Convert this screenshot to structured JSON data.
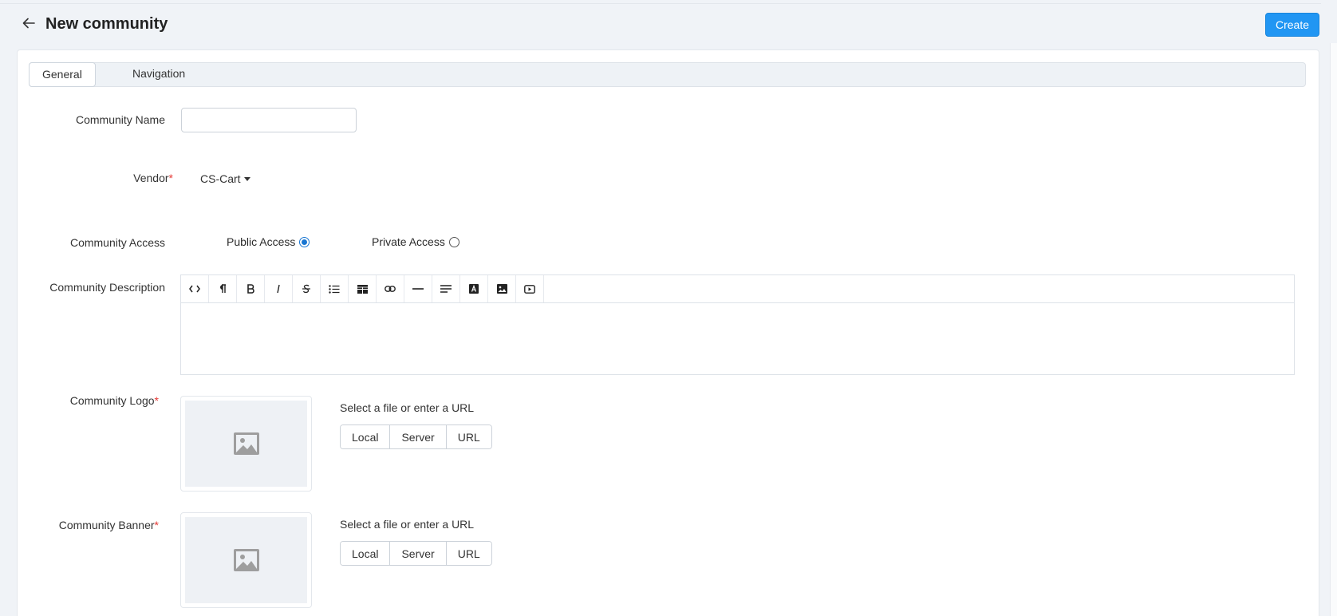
{
  "header": {
    "title": "New community",
    "create_label": "Create"
  },
  "tabs": [
    {
      "label": "General",
      "active": true
    },
    {
      "label": "Navigation",
      "active": false
    }
  ],
  "form": {
    "name_label": "Community Name",
    "name_value": "",
    "vendor_label": "Vendor",
    "vendor_value": "CS-Cart",
    "access_label": "Community Access",
    "access_options": [
      {
        "label": "Public Access",
        "checked": true
      },
      {
        "label": "Private Access",
        "checked": false
      }
    ],
    "description_label": "Community Description",
    "logo_label": "Community Logo",
    "banner_label": "Community Banner",
    "required_mark": "*",
    "upload_hint": "Select a file or enter a URL",
    "upload_sources": [
      "Local",
      "Server",
      "URL"
    ]
  },
  "editor_toolbar": [
    "code-view-icon",
    "paragraph-icon",
    "bold-icon",
    "italic-icon",
    "strikethrough-icon",
    "list-icon",
    "table-icon",
    "link-icon",
    "horizontal-rule-icon",
    "align-icon",
    "font-color-icon",
    "image-icon",
    "video-icon"
  ],
  "colors": {
    "accent": "#2196f3",
    "required": "#e53935",
    "radio_checked": "#1976d2",
    "background": "#f0f3f7"
  }
}
